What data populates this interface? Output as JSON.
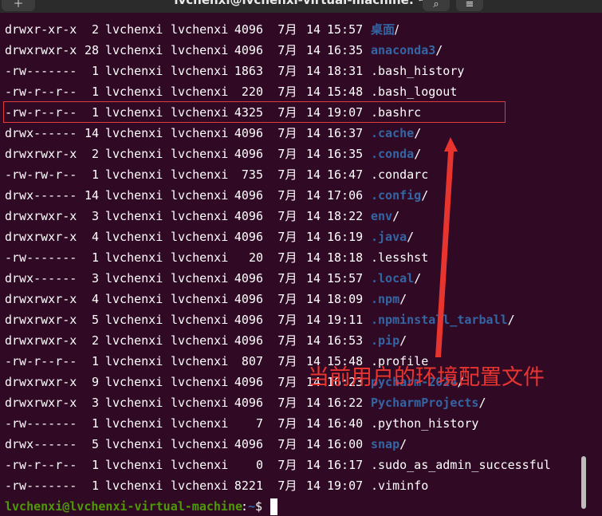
{
  "window": {
    "title": "lvchenxi@lvchenxi-virtual-machine: ~",
    "menu_icon": "new-tab-icon",
    "search_icon": "search-icon",
    "menu_burger_icon": "hamburger-menu-icon"
  },
  "listing": [
    {
      "perm": "drwxr-xr-x",
      "links": "2",
      "owner": "lvchenxi",
      "group": "lvchenxi",
      "size": "4096",
      "month": "7月",
      "day": "14",
      "time": "15:57",
      "name": "桌面",
      "kind": "dir"
    },
    {
      "perm": "drwxrwxr-x",
      "links": "28",
      "owner": "lvchenxi",
      "group": "lvchenxi",
      "size": "4096",
      "month": "7月",
      "day": "14",
      "time": "16:35",
      "name": "anaconda3",
      "kind": "dir"
    },
    {
      "perm": "-rw-------",
      "links": "1",
      "owner": "lvchenxi",
      "group": "lvchenxi",
      "size": "1863",
      "month": "7月",
      "day": "14",
      "time": "18:31",
      "name": ".bash_history",
      "kind": "file"
    },
    {
      "perm": "-rw-r--r--",
      "links": "1",
      "owner": "lvchenxi",
      "group": "lvchenxi",
      "size": "220",
      "month": "7月",
      "day": "14",
      "time": "15:48",
      "name": ".bash_logout",
      "kind": "file"
    },
    {
      "perm": "-rw-r--r--",
      "links": "1",
      "owner": "lvchenxi",
      "group": "lvchenxi",
      "size": "4325",
      "month": "7月",
      "day": "14",
      "time": "19:07",
      "name": ".bashrc",
      "kind": "file"
    },
    {
      "perm": "drwx------",
      "links": "14",
      "owner": "lvchenxi",
      "group": "lvchenxi",
      "size": "4096",
      "month": "7月",
      "day": "14",
      "time": "16:37",
      "name": ".cache",
      "kind": "dir"
    },
    {
      "perm": "drwxrwxr-x",
      "links": "2",
      "owner": "lvchenxi",
      "group": "lvchenxi",
      "size": "4096",
      "month": "7月",
      "day": "14",
      "time": "16:35",
      "name": ".conda",
      "kind": "dir"
    },
    {
      "perm": "-rw-rw-r--",
      "links": "1",
      "owner": "lvchenxi",
      "group": "lvchenxi",
      "size": "735",
      "month": "7月",
      "day": "14",
      "time": "16:47",
      "name": ".condarc",
      "kind": "file"
    },
    {
      "perm": "drwx------",
      "links": "14",
      "owner": "lvchenxi",
      "group": "lvchenxi",
      "size": "4096",
      "month": "7月",
      "day": "14",
      "time": "17:06",
      "name": ".config",
      "kind": "dir"
    },
    {
      "perm": "drwxrwxr-x",
      "links": "3",
      "owner": "lvchenxi",
      "group": "lvchenxi",
      "size": "4096",
      "month": "7月",
      "day": "14",
      "time": "18:22",
      "name": "env",
      "kind": "dir"
    },
    {
      "perm": "drwxrwxr-x",
      "links": "4",
      "owner": "lvchenxi",
      "group": "lvchenxi",
      "size": "4096",
      "month": "7月",
      "day": "14",
      "time": "16:19",
      "name": ".java",
      "kind": "dir"
    },
    {
      "perm": "-rw-------",
      "links": "1",
      "owner": "lvchenxi",
      "group": "lvchenxi",
      "size": "20",
      "month": "7月",
      "day": "14",
      "time": "18:18",
      "name": ".lesshst",
      "kind": "file"
    },
    {
      "perm": "drwx------",
      "links": "3",
      "owner": "lvchenxi",
      "group": "lvchenxi",
      "size": "4096",
      "month": "7月",
      "day": "14",
      "time": "15:57",
      "name": ".local",
      "kind": "dir"
    },
    {
      "perm": "drwxrwxr-x",
      "links": "4",
      "owner": "lvchenxi",
      "group": "lvchenxi",
      "size": "4096",
      "month": "7月",
      "day": "14",
      "time": "18:09",
      "name": ".npm",
      "kind": "dir"
    },
    {
      "perm": "drwxrwxr-x",
      "links": "5",
      "owner": "lvchenxi",
      "group": "lvchenxi",
      "size": "4096",
      "month": "7月",
      "day": "14",
      "time": "19:11",
      "name": ".npminstall_tarball",
      "kind": "dir"
    },
    {
      "perm": "drwxrwxr-x",
      "links": "2",
      "owner": "lvchenxi",
      "group": "lvchenxi",
      "size": "4096",
      "month": "7月",
      "day": "14",
      "time": "16:53",
      "name": ".pip",
      "kind": "dir"
    },
    {
      "perm": "-rw-r--r--",
      "links": "1",
      "owner": "lvchenxi",
      "group": "lvchenxi",
      "size": "807",
      "month": "7月",
      "day": "14",
      "time": "15:48",
      "name": ".profile",
      "kind": "file"
    },
    {
      "perm": "drwxrwxr-x",
      "links": "9",
      "owner": "lvchenxi",
      "group": "lvchenxi",
      "size": "4096",
      "month": "7月",
      "day": "14",
      "time": "16:23",
      "name": "pycharm-2024",
      "kind": "dir"
    },
    {
      "perm": "drwxrwxr-x",
      "links": "3",
      "owner": "lvchenxi",
      "group": "lvchenxi",
      "size": "4096",
      "month": "7月",
      "day": "14",
      "time": "16:22",
      "name": "PycharmProjects",
      "kind": "dir"
    },
    {
      "perm": "-rw-------",
      "links": "1",
      "owner": "lvchenxi",
      "group": "lvchenxi",
      "size": "7",
      "month": "7月",
      "day": "14",
      "time": "16:40",
      "name": ".python_history",
      "kind": "file"
    },
    {
      "perm": "drwx------",
      "links": "5",
      "owner": "lvchenxi",
      "group": "lvchenxi",
      "size": "4096",
      "month": "7月",
      "day": "14",
      "time": "16:00",
      "name": "snap",
      "kind": "dir"
    },
    {
      "perm": "-rw-r--r--",
      "links": "1",
      "owner": "lvchenxi",
      "group": "lvchenxi",
      "size": "0",
      "month": "7月",
      "day": "14",
      "time": "16:17",
      "name": ".sudo_as_admin_successful",
      "kind": "file"
    },
    {
      "perm": "-rw-------",
      "links": "1",
      "owner": "lvchenxi",
      "group": "lvchenxi",
      "size": "8221",
      "month": "7月",
      "day": "14",
      "time": "19:07",
      "name": ".viminfo",
      "kind": "file"
    }
  ],
  "prompt": {
    "user_host": "lvchenxi@lvchenxi-virtual-machine",
    "colon": ":",
    "path": "~",
    "sign": "$"
  },
  "annotation": {
    "text": "当前用户的环境配置文件",
    "color": "#e8342f"
  },
  "colors": {
    "background": "#300a24",
    "directory": "#3465a4",
    "prompt_user": "#4e9a06",
    "highlight": "#e23b3b"
  }
}
